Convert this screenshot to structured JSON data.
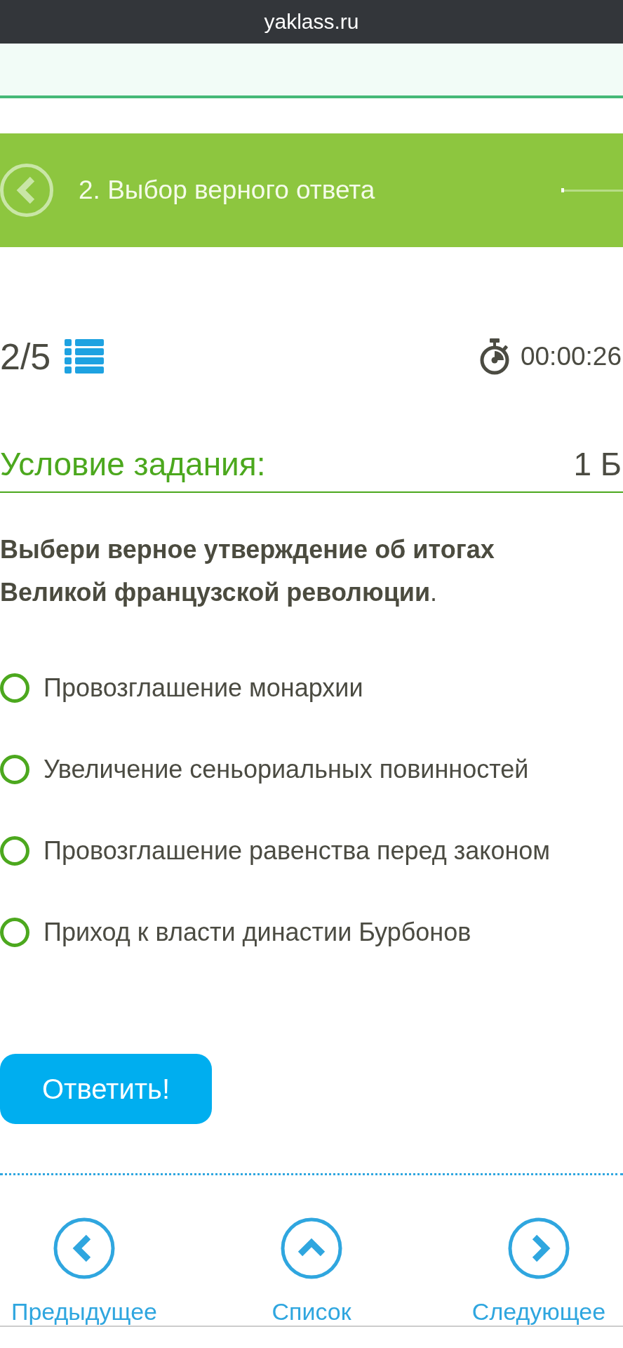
{
  "browser": {
    "address": "yaklass.ru"
  },
  "header": {
    "title": "2. Выбор верного ответа"
  },
  "status": {
    "counter": "2/5",
    "timer": "00:00:26"
  },
  "task": {
    "heading": "Условие задания:",
    "points": "1 Б",
    "question": "**Выбери верное утверждение об итогах Великой французской революции**.",
    "options": [
      {
        "label": "Провозглашение монархии",
        "selected": false
      },
      {
        "label": "Увеличение сеньориальных повинностей",
        "selected": false
      },
      {
        "label": "Провозглашение равенства перед законом",
        "selected": false
      },
      {
        "label": "Приход к власти династии Бурбонов",
        "selected": false
      }
    ]
  },
  "submit_button": "Ответить!",
  "navigation": [
    {
      "kind": "previous",
      "label": "Предыдущее"
    },
    {
      "kind": "list",
      "label": "Список"
    },
    {
      "kind": "next",
      "label": "Следующее"
    }
  ]
}
